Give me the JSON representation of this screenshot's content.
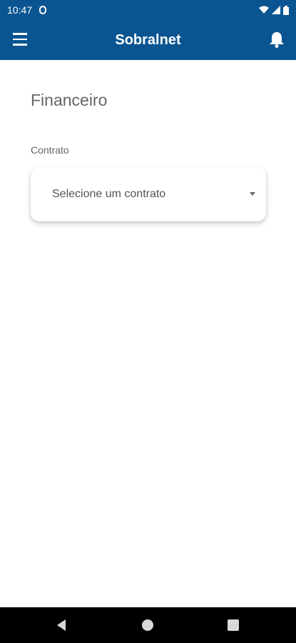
{
  "status_bar": {
    "time": "10:47",
    "icons": [
      "app-notification-icon",
      "wifi-icon",
      "signal-icon",
      "battery-icon"
    ]
  },
  "app_bar": {
    "title": "Sobralnet",
    "menu_icon": "menu-icon",
    "notification_icon": "bell-icon",
    "color": "#0a5591"
  },
  "main": {
    "page_title": "Financeiro",
    "contract_label": "Contrato",
    "contract_select": {
      "value": "Selecione um contrato",
      "icon": "dropdown-arrow-icon"
    }
  },
  "nav_bar": {
    "buttons": [
      "back-icon",
      "home-icon",
      "recents-icon"
    ]
  }
}
